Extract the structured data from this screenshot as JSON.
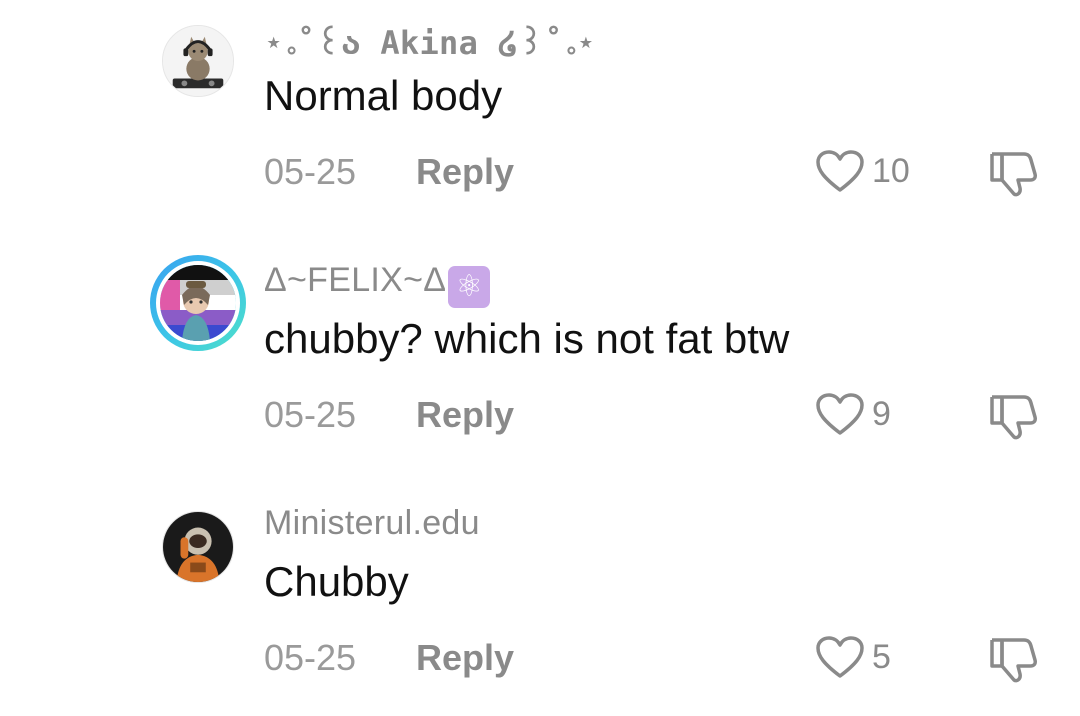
{
  "comments": [
    {
      "username": "⋆｡˚꒰ა Akina ໒꒱˚｡⋆",
      "text": "Normal body",
      "date": "05-25",
      "reply_label": "Reply",
      "likes": "10",
      "avatar_icon": "dj-cat-avatar"
    },
    {
      "username": "Δ~FELIX~Δ",
      "username_emoji": "⚛",
      "text": "chubby? which is not fat btw",
      "date": "05-25",
      "reply_label": "Reply",
      "likes": "9",
      "avatar_icon": "anime-character-avatar"
    },
    {
      "username": "Ministerul.edu",
      "text": "Chubby",
      "date": "05-25",
      "reply_label": "Reply",
      "likes": "5",
      "avatar_icon": "astronaut-avatar"
    }
  ],
  "colors": {
    "text_primary": "#111111",
    "text_secondary": "#8a8a8a",
    "ring_gradient_start": "#3aa0f0",
    "ring_gradient_end": "#4fe0c8",
    "emoji_badge": "#c9a8e8"
  }
}
